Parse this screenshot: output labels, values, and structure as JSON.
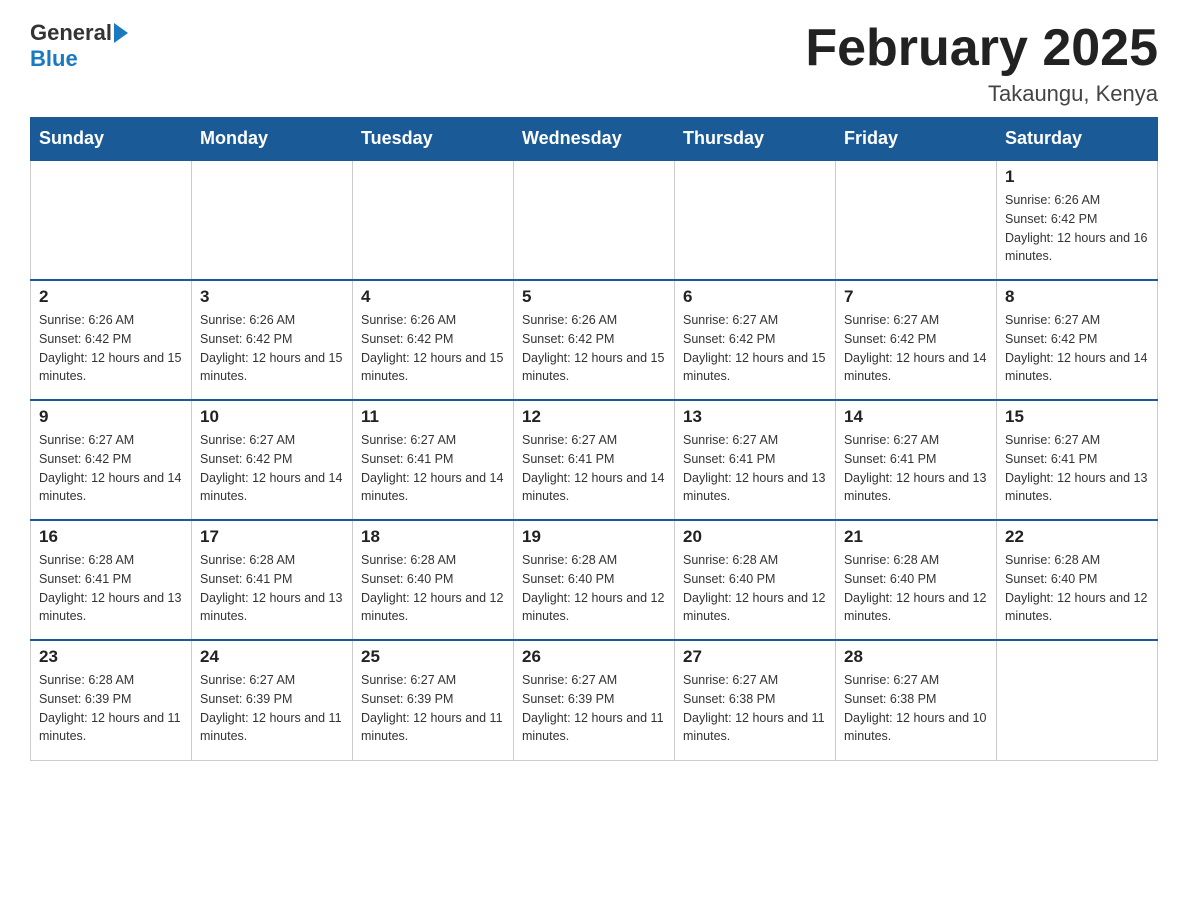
{
  "header": {
    "logo": {
      "general": "General",
      "blue": "Blue"
    },
    "title": "February 2025",
    "subtitle": "Takaungu, Kenya"
  },
  "weekdays": [
    "Sunday",
    "Monday",
    "Tuesday",
    "Wednesday",
    "Thursday",
    "Friday",
    "Saturday"
  ],
  "weeks": [
    [
      {
        "day": "",
        "sunrise": "",
        "sunset": "",
        "daylight": "",
        "empty": true
      },
      {
        "day": "",
        "sunrise": "",
        "sunset": "",
        "daylight": "",
        "empty": true
      },
      {
        "day": "",
        "sunrise": "",
        "sunset": "",
        "daylight": "",
        "empty": true
      },
      {
        "day": "",
        "sunrise": "",
        "sunset": "",
        "daylight": "",
        "empty": true
      },
      {
        "day": "",
        "sunrise": "",
        "sunset": "",
        "daylight": "",
        "empty": true
      },
      {
        "day": "",
        "sunrise": "",
        "sunset": "",
        "daylight": "",
        "empty": true
      },
      {
        "day": "1",
        "sunrise": "Sunrise: 6:26 AM",
        "sunset": "Sunset: 6:42 PM",
        "daylight": "Daylight: 12 hours and 16 minutes.",
        "empty": false
      }
    ],
    [
      {
        "day": "2",
        "sunrise": "Sunrise: 6:26 AM",
        "sunset": "Sunset: 6:42 PM",
        "daylight": "Daylight: 12 hours and 15 minutes.",
        "empty": false
      },
      {
        "day": "3",
        "sunrise": "Sunrise: 6:26 AM",
        "sunset": "Sunset: 6:42 PM",
        "daylight": "Daylight: 12 hours and 15 minutes.",
        "empty": false
      },
      {
        "day": "4",
        "sunrise": "Sunrise: 6:26 AM",
        "sunset": "Sunset: 6:42 PM",
        "daylight": "Daylight: 12 hours and 15 minutes.",
        "empty": false
      },
      {
        "day": "5",
        "sunrise": "Sunrise: 6:26 AM",
        "sunset": "Sunset: 6:42 PM",
        "daylight": "Daylight: 12 hours and 15 minutes.",
        "empty": false
      },
      {
        "day": "6",
        "sunrise": "Sunrise: 6:27 AM",
        "sunset": "Sunset: 6:42 PM",
        "daylight": "Daylight: 12 hours and 15 minutes.",
        "empty": false
      },
      {
        "day": "7",
        "sunrise": "Sunrise: 6:27 AM",
        "sunset": "Sunset: 6:42 PM",
        "daylight": "Daylight: 12 hours and 14 minutes.",
        "empty": false
      },
      {
        "day": "8",
        "sunrise": "Sunrise: 6:27 AM",
        "sunset": "Sunset: 6:42 PM",
        "daylight": "Daylight: 12 hours and 14 minutes.",
        "empty": false
      }
    ],
    [
      {
        "day": "9",
        "sunrise": "Sunrise: 6:27 AM",
        "sunset": "Sunset: 6:42 PM",
        "daylight": "Daylight: 12 hours and 14 minutes.",
        "empty": false
      },
      {
        "day": "10",
        "sunrise": "Sunrise: 6:27 AM",
        "sunset": "Sunset: 6:42 PM",
        "daylight": "Daylight: 12 hours and 14 minutes.",
        "empty": false
      },
      {
        "day": "11",
        "sunrise": "Sunrise: 6:27 AM",
        "sunset": "Sunset: 6:41 PM",
        "daylight": "Daylight: 12 hours and 14 minutes.",
        "empty": false
      },
      {
        "day": "12",
        "sunrise": "Sunrise: 6:27 AM",
        "sunset": "Sunset: 6:41 PM",
        "daylight": "Daylight: 12 hours and 14 minutes.",
        "empty": false
      },
      {
        "day": "13",
        "sunrise": "Sunrise: 6:27 AM",
        "sunset": "Sunset: 6:41 PM",
        "daylight": "Daylight: 12 hours and 13 minutes.",
        "empty": false
      },
      {
        "day": "14",
        "sunrise": "Sunrise: 6:27 AM",
        "sunset": "Sunset: 6:41 PM",
        "daylight": "Daylight: 12 hours and 13 minutes.",
        "empty": false
      },
      {
        "day": "15",
        "sunrise": "Sunrise: 6:27 AM",
        "sunset": "Sunset: 6:41 PM",
        "daylight": "Daylight: 12 hours and 13 minutes.",
        "empty": false
      }
    ],
    [
      {
        "day": "16",
        "sunrise": "Sunrise: 6:28 AM",
        "sunset": "Sunset: 6:41 PM",
        "daylight": "Daylight: 12 hours and 13 minutes.",
        "empty": false
      },
      {
        "day": "17",
        "sunrise": "Sunrise: 6:28 AM",
        "sunset": "Sunset: 6:41 PM",
        "daylight": "Daylight: 12 hours and 13 minutes.",
        "empty": false
      },
      {
        "day": "18",
        "sunrise": "Sunrise: 6:28 AM",
        "sunset": "Sunset: 6:40 PM",
        "daylight": "Daylight: 12 hours and 12 minutes.",
        "empty": false
      },
      {
        "day": "19",
        "sunrise": "Sunrise: 6:28 AM",
        "sunset": "Sunset: 6:40 PM",
        "daylight": "Daylight: 12 hours and 12 minutes.",
        "empty": false
      },
      {
        "day": "20",
        "sunrise": "Sunrise: 6:28 AM",
        "sunset": "Sunset: 6:40 PM",
        "daylight": "Daylight: 12 hours and 12 minutes.",
        "empty": false
      },
      {
        "day": "21",
        "sunrise": "Sunrise: 6:28 AM",
        "sunset": "Sunset: 6:40 PM",
        "daylight": "Daylight: 12 hours and 12 minutes.",
        "empty": false
      },
      {
        "day": "22",
        "sunrise": "Sunrise: 6:28 AM",
        "sunset": "Sunset: 6:40 PM",
        "daylight": "Daylight: 12 hours and 12 minutes.",
        "empty": false
      }
    ],
    [
      {
        "day": "23",
        "sunrise": "Sunrise: 6:28 AM",
        "sunset": "Sunset: 6:39 PM",
        "daylight": "Daylight: 12 hours and 11 minutes.",
        "empty": false
      },
      {
        "day": "24",
        "sunrise": "Sunrise: 6:27 AM",
        "sunset": "Sunset: 6:39 PM",
        "daylight": "Daylight: 12 hours and 11 minutes.",
        "empty": false
      },
      {
        "day": "25",
        "sunrise": "Sunrise: 6:27 AM",
        "sunset": "Sunset: 6:39 PM",
        "daylight": "Daylight: 12 hours and 11 minutes.",
        "empty": false
      },
      {
        "day": "26",
        "sunrise": "Sunrise: 6:27 AM",
        "sunset": "Sunset: 6:39 PM",
        "daylight": "Daylight: 12 hours and 11 minutes.",
        "empty": false
      },
      {
        "day": "27",
        "sunrise": "Sunrise: 6:27 AM",
        "sunset": "Sunset: 6:38 PM",
        "daylight": "Daylight: 12 hours and 11 minutes.",
        "empty": false
      },
      {
        "day": "28",
        "sunrise": "Sunrise: 6:27 AM",
        "sunset": "Sunset: 6:38 PM",
        "daylight": "Daylight: 12 hours and 10 minutes.",
        "empty": false
      },
      {
        "day": "",
        "sunrise": "",
        "sunset": "",
        "daylight": "",
        "empty": true
      }
    ]
  ]
}
